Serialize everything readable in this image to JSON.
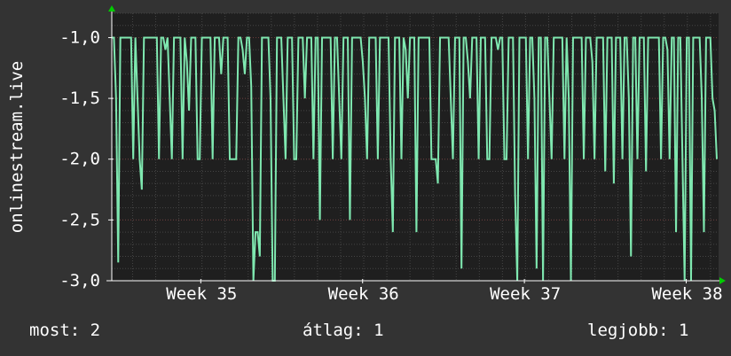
{
  "chart_data": {
    "type": "line",
    "ylabel": "onlinestream.live",
    "ylim": [
      -3.0,
      -0.8
    ],
    "y_ticks": [
      {
        "value": -1.0,
        "label": "-1,0"
      },
      {
        "value": -1.5,
        "label": "-1,5"
      },
      {
        "value": -2.0,
        "label": "-2,0"
      },
      {
        "value": -2.5,
        "label": "-2,5"
      },
      {
        "value": -3.0,
        "label": "-3,0"
      }
    ],
    "xlim": [
      34.3,
      38.05
    ],
    "x_ticks": [
      {
        "value": 34.85,
        "label": "Week 35"
      },
      {
        "value": 35.85,
        "label": "Week 36"
      },
      {
        "value": 36.85,
        "label": "Week 37"
      },
      {
        "value": 37.85,
        "label": "Week 38"
      }
    ],
    "grid": true,
    "colors": {
      "background": "#333333",
      "plot_bg": "#1f1f1f",
      "grid_minor": "#454545",
      "grid_major": "#6a3a3a",
      "line": "#7fe8b0",
      "axis": "#ffffff",
      "arrow": "#00cc00"
    },
    "series": [
      {
        "values": [
          -1.0,
          -1.0,
          -1.5,
          -2.85,
          -1.0,
          -1.0,
          -1.0,
          -1.0,
          -1.0,
          -1.0,
          -2.0,
          -1.0,
          -1.5,
          -2.0,
          -2.25,
          -1.0,
          -1.0,
          -1.0,
          -1.0,
          -1.0,
          -1.0,
          -1.0,
          -2.0,
          -1.0,
          -1.0,
          -1.1,
          -1.0,
          -1.5,
          -2.0,
          -1.0,
          -1.0,
          -1.0,
          -1.0,
          -2.0,
          -1.0,
          -1.2,
          -1.6,
          -1.0,
          -1.0,
          -1.0,
          -2.0,
          -2.0,
          -1.0,
          -1.0,
          -1.0,
          -1.0,
          -1.0,
          -2.0,
          -1.0,
          -1.0,
          -1.0,
          -1.3,
          -1.0,
          -1.0,
          -1.0,
          -2.0,
          -2.0,
          -2.0,
          -2.0,
          -1.0,
          -1.0,
          -1.1,
          -1.3,
          -1.0,
          -1.0,
          -1.4,
          -3.0,
          -2.6,
          -2.6,
          -2.8,
          -1.0,
          -1.0,
          -1.0,
          -1.0,
          -1.5,
          -3.0,
          -3.0,
          -1.0,
          -1.0,
          -1.0,
          -1.5,
          -2.0,
          -1.0,
          -1.0,
          -1.0,
          -2.0,
          -2.0,
          -1.0,
          -1.0,
          -1.0,
          -1.5,
          -1.0,
          -1.0,
          -1.0,
          -2.0,
          -1.0,
          -1.0,
          -2.5,
          -1.0,
          -1.0,
          -1.0,
          -1.0,
          -1.0,
          -2.0,
          -1.0,
          -1.0,
          -1.5,
          -2.0,
          -1.0,
          -1.0,
          -1.0,
          -2.5,
          -1.0,
          -1.0,
          -1.0,
          -1.0,
          -1.0,
          -1.2,
          -1.5,
          -2.0,
          -1.0,
          -1.0,
          -1.0,
          -1.0,
          -2.0,
          -1.0,
          -1.0,
          -1.0,
          -1.0,
          -1.0,
          -2.0,
          -2.6,
          -1.0,
          -1.0,
          -1.0,
          -2.0,
          -1.0,
          -1.1,
          -1.5,
          -1.0,
          -1.0,
          -1.0,
          -2.6,
          -1.0,
          -1.0,
          -1.0,
          -1.0,
          -1.0,
          -1.0,
          -2.0,
          -2.0,
          -2.0,
          -2.2,
          -1.0,
          -1.0,
          -1.0,
          -1.0,
          -1.0,
          -1.5,
          -2.0,
          -1.0,
          -1.0,
          -1.0,
          -2.9,
          -1.0,
          -1.0,
          -1.2,
          -1.5,
          -1.0,
          -1.0,
          -1.0,
          -2.0,
          -1.0,
          -1.0,
          -1.0,
          -2.0,
          -2.0,
          -1.0,
          -1.0,
          -1.0,
          -1.1,
          -1.0,
          -1.0,
          -2.0,
          -2.0,
          -1.0,
          -1.0,
          -1.0,
          -2.3,
          -3.0,
          -1.0,
          -1.0,
          -1.0,
          -1.0,
          -2.0,
          -1.0,
          -1.0,
          -1.5,
          -2.9,
          -1.0,
          -1.0,
          -3.0,
          -1.0,
          -1.0,
          -1.5,
          -2.0,
          -1.0,
          -1.0,
          -1.0,
          -1.0,
          -1.0,
          -2.0,
          -1.0,
          -1.5,
          -3.0,
          -1.0,
          -1.0,
          -1.0,
          -1.0,
          -1.0,
          -2.0,
          -1.0,
          -1.0,
          -1.0,
          -1.2,
          -2.0,
          -1.0,
          -1.0,
          -1.0,
          -1.0,
          -2.1,
          -1.0,
          -1.0,
          -1.0,
          -2.2,
          -1.0,
          -1.0,
          -1.0,
          -2.0,
          -1.0,
          -1.0,
          -1.5,
          -2.8,
          -1.0,
          -1.0,
          -2.0,
          -1.0,
          -1.0,
          -1.0,
          -2.1,
          -1.0,
          -1.0,
          -1.0,
          -1.0,
          -1.0,
          -1.0,
          -2.0,
          -1.0,
          -1.0,
          -1.1,
          -2.0,
          -1.0,
          -1.0,
          -2.6,
          -1.0,
          -1.0,
          -2.0,
          -3.0,
          -1.0,
          -1.0,
          -3.0,
          -1.0,
          -1.0,
          -1.0,
          -1.0,
          -1.5,
          -2.6,
          -1.0,
          -1.0,
          -1.0,
          -1.5,
          -1.6,
          -2.0
        ]
      }
    ]
  },
  "stats": {
    "current": "most: 2",
    "average": "átlag: 1",
    "best": "legjobb: 1"
  }
}
